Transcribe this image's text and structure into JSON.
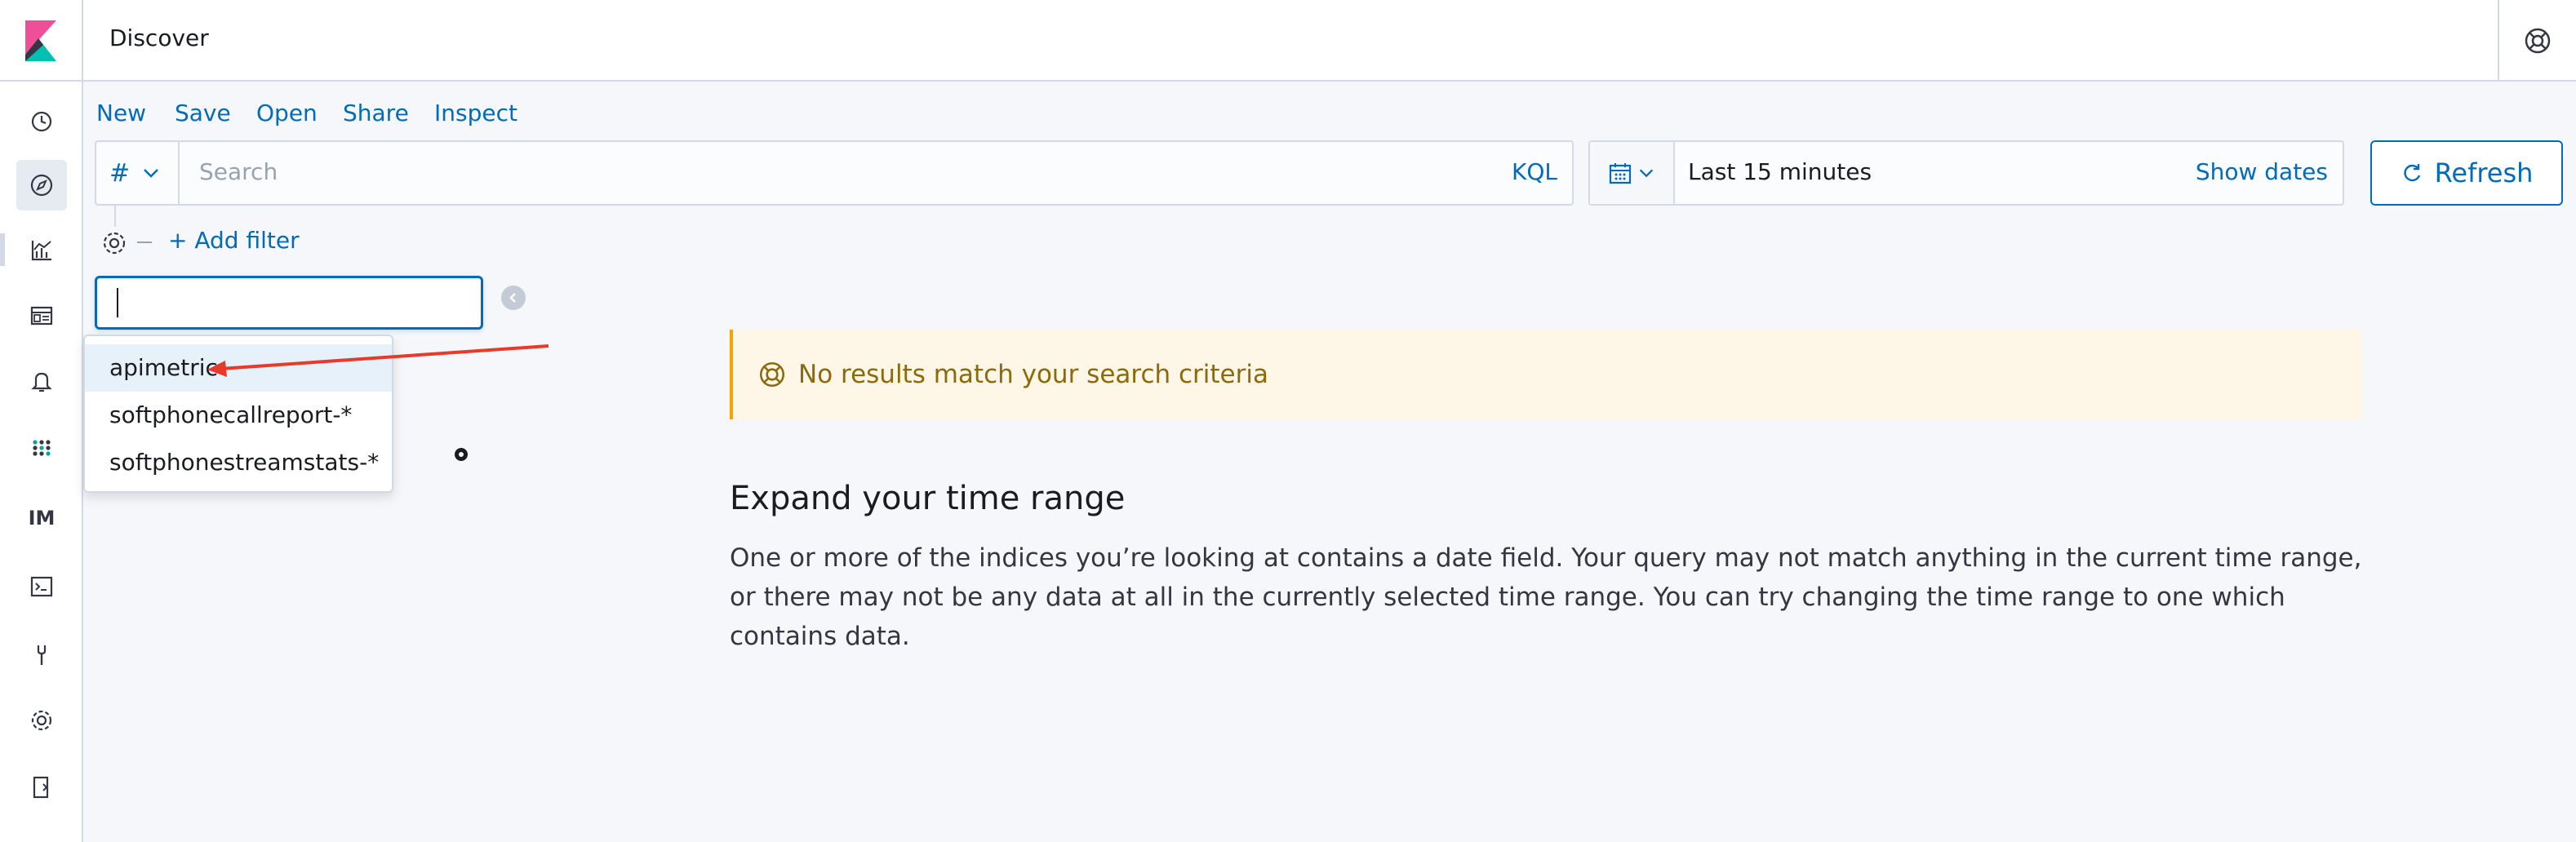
{
  "header": {
    "title": "Discover",
    "logo": "kibana-logo",
    "help_icon": "help-icon"
  },
  "leftnav": {
    "items": [
      {
        "name": "recently-viewed",
        "icon": "clock-icon"
      },
      {
        "name": "discover",
        "icon": "compass-icon",
        "active": true
      },
      {
        "name": "visualize",
        "icon": "chart-icon"
      },
      {
        "name": "dashboard",
        "icon": "dashboard-icon"
      },
      {
        "name": "alerting",
        "icon": "bell-icon"
      },
      {
        "name": "machine-learning",
        "icon": "grid-icon"
      },
      {
        "name": "im",
        "label": "IM"
      },
      {
        "name": "dev-tools",
        "icon": "console-icon"
      },
      {
        "name": "monitoring",
        "icon": "wrench-icon"
      },
      {
        "name": "management",
        "icon": "gear-icon"
      },
      {
        "name": "logout",
        "icon": "logout-icon"
      }
    ]
  },
  "topnav": {
    "new": "New",
    "save": "Save",
    "open": "Open",
    "share": "Share",
    "inspect": "Inspect"
  },
  "query": {
    "lang_symbol": "#",
    "placeholder": "Search",
    "kql": "KQL"
  },
  "datepicker": {
    "range": "Last 15 minutes",
    "show_dates": "Show dates"
  },
  "refresh": {
    "label": "Refresh"
  },
  "filter": {
    "add_label": "+ Add filter"
  },
  "index_pattern": {
    "input_value": "",
    "options": [
      "apimetric",
      "softphonecallreport-*",
      "softphonestreamstats-*"
    ],
    "focused_index": 0
  },
  "callout": {
    "title": "No results match your search criteria"
  },
  "empty_state": {
    "title": "Expand your time range",
    "body": "One or more of the indices you’re looking at contains a date field. Your query may not match anything in the current time range, or there may not be any data at all in the currently selected time range. You can try changing the time range to one which contains data."
  },
  "colors": {
    "accent": "#006bb8",
    "warning_bg": "#fef6e6",
    "warning_border": "#f5a700",
    "annotation_arrow": "#e8392b"
  }
}
